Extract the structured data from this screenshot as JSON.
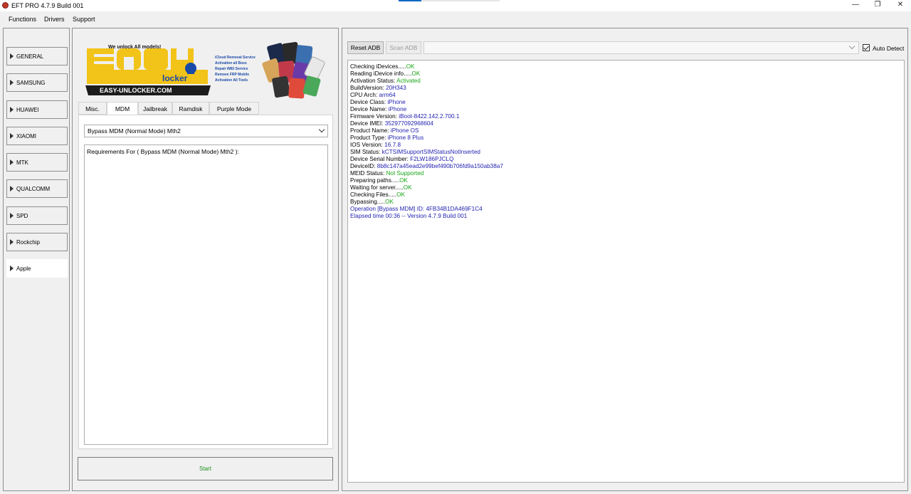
{
  "window": {
    "title": "EFT PRO 4.7.9 Build 001",
    "minimize_glyph": "—",
    "maximize_glyph": "❐",
    "close_glyph": "✕"
  },
  "menu": [
    "Functions",
    "Drivers",
    "Support"
  ],
  "categories": [
    "GENERAL",
    "SAMSUNG",
    "HUAWEI",
    "XIAOMI",
    "MTK",
    "QUALCOMM",
    "SPD",
    "Rockchip",
    "Apple"
  ],
  "active_category": "Apple",
  "banner": {
    "tagline": "We unlock All models!",
    "logo_top": "EASY",
    "logo_sub": "locker",
    "site": "EASY-UNLOCKER.COM",
    "features": [
      "iCloud Removal Service",
      "Activation all Boss",
      "Repair IMEI Service",
      "Remove FRP Mobile",
      "Activation All Tools"
    ]
  },
  "tabs": [
    "Misc.",
    "MDM",
    "Jailbreak",
    "Ramdisk",
    "Purple Mode"
  ],
  "active_tab": "MDM",
  "operation_select": "Bypass MDM (Normal Mode) Mth2",
  "requirements_text": "Requirements For ( Bypass MDM (Normal Mode) Mth2 ):",
  "start_label": "Start",
  "toolbar": {
    "reset_adb": "Reset ADB",
    "scan_adb": "Scan ADB",
    "auto_detect": "Auto Detect",
    "auto_detect_checked": true
  },
  "log": [
    {
      "key": "Checking iDevices.....",
      "value": "OK",
      "style": "ok"
    },
    {
      "key": "Reading iDevice info.....",
      "value": "OK",
      "style": "ok"
    },
    {
      "key": "Activation Status: ",
      "value": "Activated",
      "style": "green"
    },
    {
      "key": "BuildVersion: ",
      "value": "20H343",
      "style": "blue"
    },
    {
      "key": "CPU Arch: ",
      "value": "arm64",
      "style": "blue"
    },
    {
      "key": "Device Class: ",
      "value": "iPhone",
      "style": "blue"
    },
    {
      "key": "Device Name: ",
      "value": "iPhone",
      "style": "blue"
    },
    {
      "key": "Firmware Version: ",
      "value": "iBoot-8422.142.2.700.1",
      "style": "blue"
    },
    {
      "key": "Device IMEI: ",
      "value": "352977092968604",
      "style": "blue"
    },
    {
      "key": "Product Name: ",
      "value": "iPhone OS",
      "style": "blue"
    },
    {
      "key": "Product Type: ",
      "value": "iPhone 8 Plus",
      "style": "blue"
    },
    {
      "key": "IOS Version: ",
      "value": "16.7.8",
      "style": "blue"
    },
    {
      "key": "SIM Status: ",
      "value": "kCTSIMSupportSIMStatusNotInserted",
      "style": "blue"
    },
    {
      "key": "Device Serial Number: ",
      "value": "F2LW186PJCLQ",
      "style": "blue"
    },
    {
      "key": "DeviceID: ",
      "value": "8b8c147a45ead2e99bef490b706fd9a150ab38a7",
      "style": "blue"
    },
    {
      "key": "MEID Status: ",
      "value": "Not Supported",
      "style": "green"
    },
    {
      "key": "Preparing paths.....",
      "value": "OK",
      "style": "ok"
    },
    {
      "key": "Waiting for server.....",
      "value": "OK",
      "style": "ok"
    },
    {
      "key": "Checking Files.....",
      "value": "OK",
      "style": "ok"
    },
    {
      "key": "Bypassing.....",
      "value": "OK",
      "style": "ok"
    },
    {
      "key": "",
      "value": "Operation [Bypass MDM] ID: 4FB34B1DA469F1C4",
      "style": "blue"
    },
    {
      "key": "",
      "value": "Elapsed time 00:36 -- Version 4.7.9 Build 001",
      "style": "blue"
    }
  ]
}
